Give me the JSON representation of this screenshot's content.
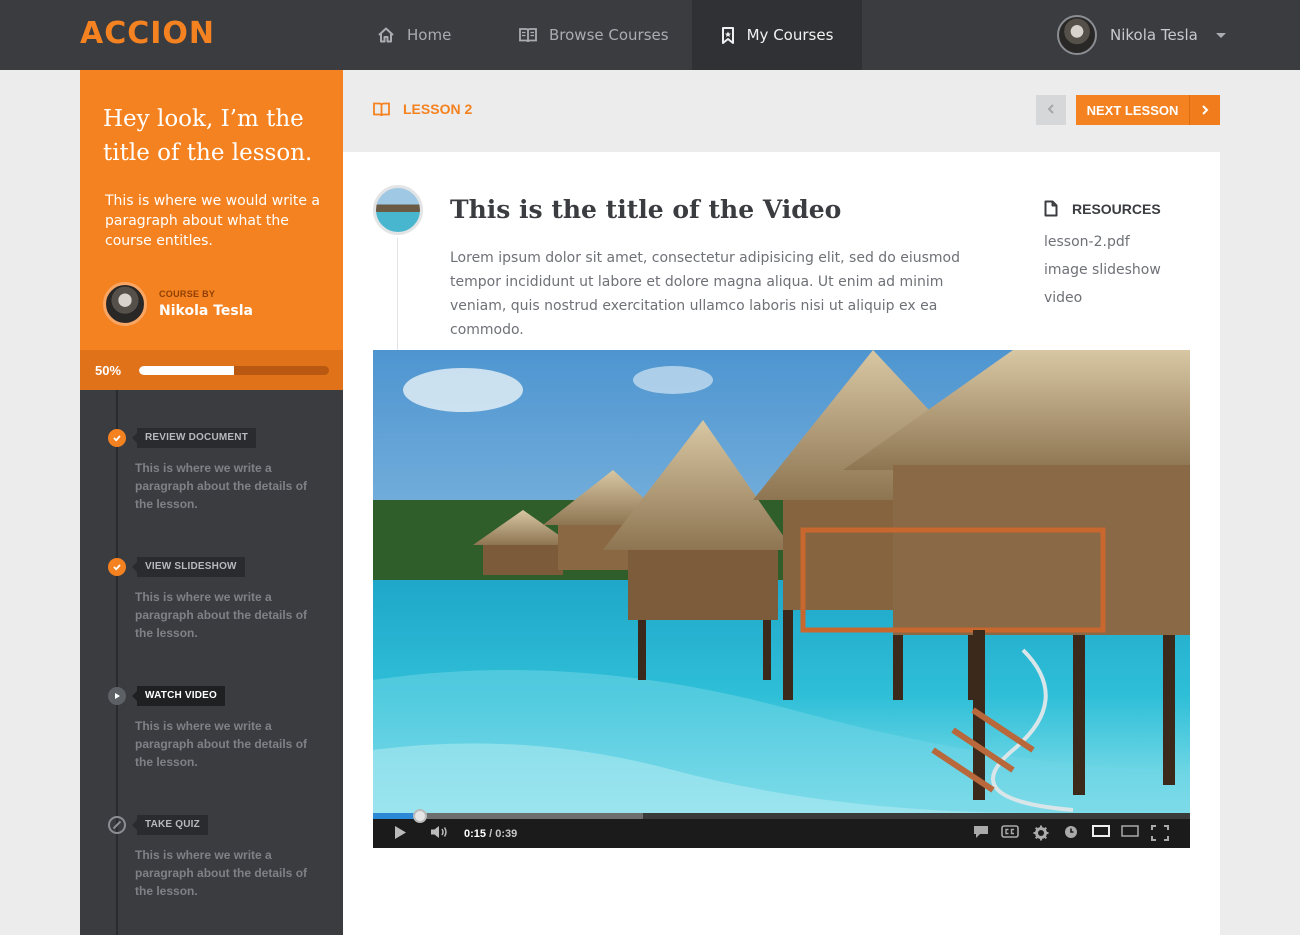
{
  "brand": {
    "logo": "ACCION",
    "accent": "#f58220"
  },
  "nav": {
    "items": [
      {
        "label": "Home",
        "icon": "home-icon"
      },
      {
        "label": "Browse Courses",
        "icon": "book-icon"
      },
      {
        "label": "My Courses",
        "icon": "bookmark-icon",
        "active": true
      }
    ]
  },
  "user": {
    "name": "Nikola Tesla"
  },
  "lesson": {
    "title": "Hey look, I’m the title of the lesson.",
    "description": "This is where we would write a paragraph about what the course entitles.",
    "author_label": "COURSE BY",
    "author_name": "Nikola Tesla",
    "progress_label": "50%",
    "progress": 0.5,
    "label": "LESSON 2",
    "next_label": "NEXT LESSON"
  },
  "steps": [
    {
      "tag": "REVIEW DOCUMENT",
      "status": "done",
      "desc": "This is where we write a paragraph about the details of the lesson."
    },
    {
      "tag": "VIEW SLIDESHOW",
      "status": "done",
      "desc": "This is where we write a paragraph about the details of the lesson."
    },
    {
      "tag": "WATCH VIDEO",
      "status": "current",
      "desc": "This is where we write a paragraph about the details of the lesson."
    },
    {
      "tag": "TAKE QUIZ",
      "status": "locked",
      "desc": "This is where we write a paragraph about the details of the lesson."
    }
  ],
  "video": {
    "title": "This is the title of the Video",
    "description": "Lorem ipsum dolor sit amet, consectetur adipisicing elit, sed do eiusmod tempor incididunt ut labore et dolore magna aliqua. Ut enim ad minim veniam, quis nostrud exercitation ullamco laboris nisi ut aliquip ex ea commodo.",
    "current_time": "0:15",
    "duration": "0:39",
    "played_fraction": 0.057,
    "buffered_fraction": 0.33
  },
  "resources": {
    "heading": "RESOURCES",
    "items": [
      "lesson-2.pdf",
      "image slideshow",
      "video"
    ]
  }
}
